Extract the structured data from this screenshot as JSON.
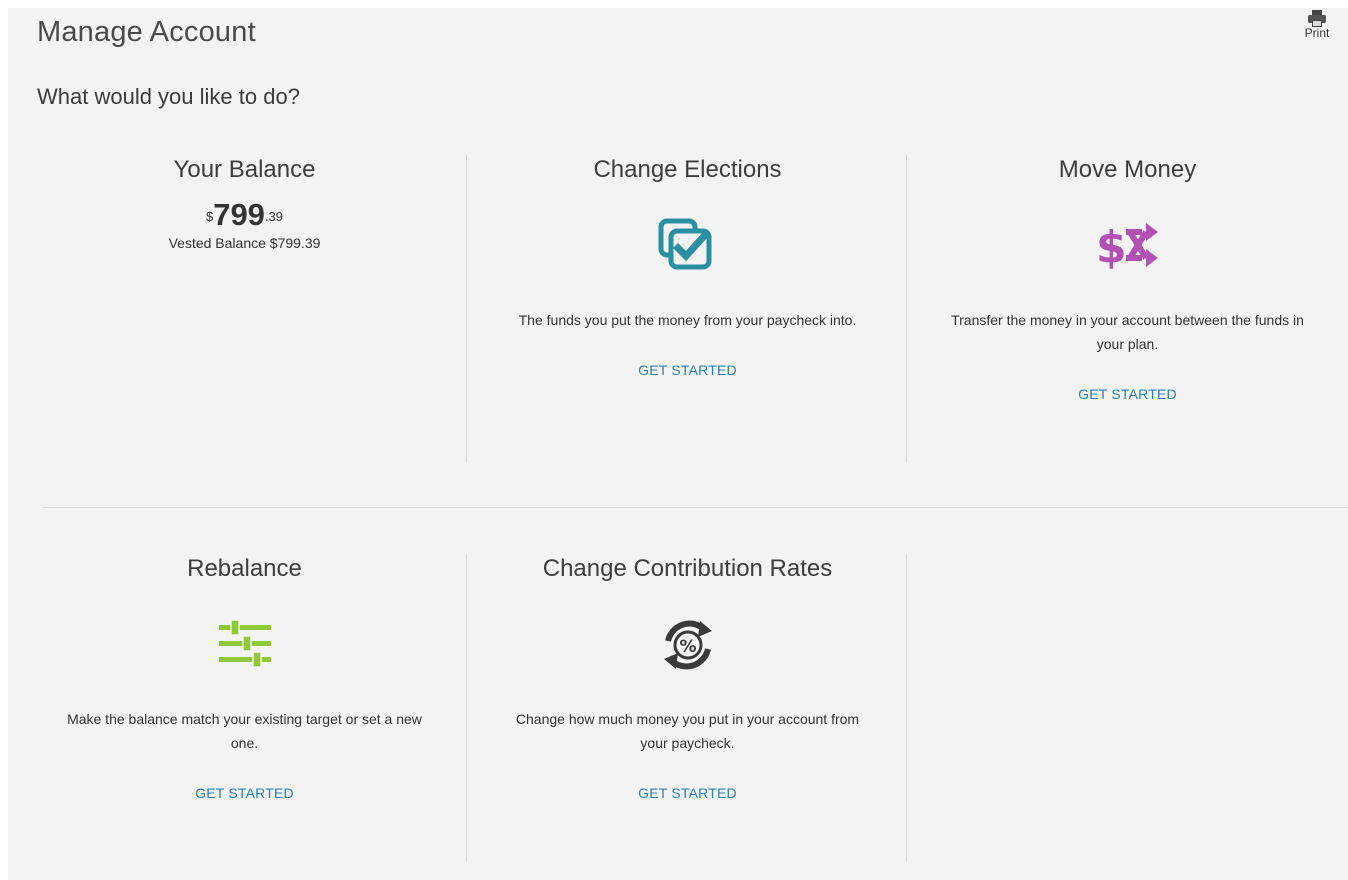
{
  "header": {
    "title": "Manage Account",
    "print_label": "Print"
  },
  "subtitle": "What would you like to do?",
  "balance": {
    "title": "Your Balance",
    "currency": "$",
    "dollars": "799",
    "cents": ".39",
    "vested_text": "Vested Balance $799.39"
  },
  "cards": {
    "change_elections": {
      "title": "Change Elections",
      "description": "The funds you put the money from your paycheck into.",
      "cta": "GET STARTED",
      "icon": "checkbox-stack-icon",
      "color": "#2a8fa0"
    },
    "move_money": {
      "title": "Move Money",
      "description": "Transfer the money in your account between the funds in your plan.",
      "cta": "GET STARTED",
      "icon": "dollar-shuffle-icon",
      "color": "#b34fb5"
    },
    "rebalance": {
      "title": "Rebalance",
      "description": "Make the balance match your existing target or set a new one.",
      "cta": "GET STARTED",
      "icon": "sliders-icon",
      "color": "#8fc93a"
    },
    "change_contribution_rates": {
      "title": "Change Contribution Rates",
      "description": "Change how much money you put in your account from your paycheck.",
      "cta": "GET STARTED",
      "icon": "percent-refresh-icon",
      "color": "#3a3a3a"
    }
  },
  "colors": {
    "link": "#2a80b9",
    "panel_background": "#f3f3f3"
  }
}
